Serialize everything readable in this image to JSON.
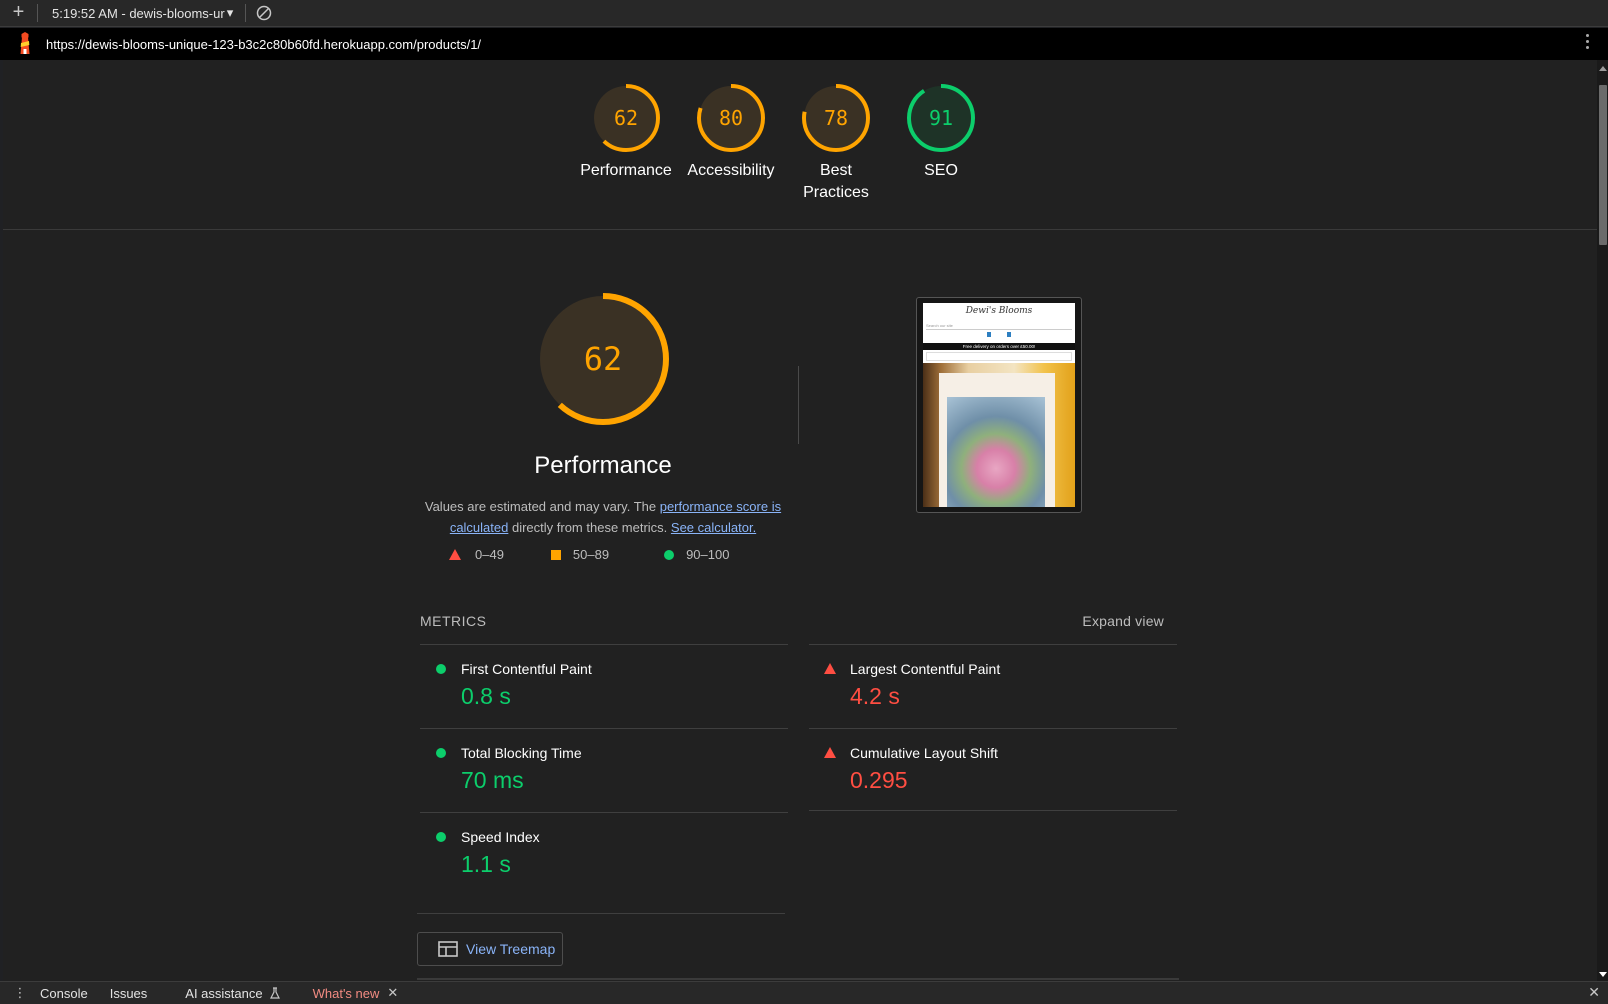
{
  "topbar": {
    "add_label": "+",
    "report_select": "5:19:52 AM - dewis-blooms-ur",
    "report_select_arrow": "▾"
  },
  "urlbar": {
    "url": "https://dewis-blooms-unique-123-b3c2c80b60fd.herokuapp.com/products/1/"
  },
  "summary": {
    "gauges": [
      {
        "score": "62",
        "label": "Performance",
        "value": 62,
        "color": "#ffa400"
      },
      {
        "score": "80",
        "label": "Accessibility",
        "value": 80,
        "color": "#ffa400"
      },
      {
        "score": "78",
        "label": "Best Practices",
        "value": 78,
        "color": "#ffa400"
      },
      {
        "score": "91",
        "label": "SEO",
        "value": 91,
        "color": "#0cce6b"
      }
    ]
  },
  "performance": {
    "score": "62",
    "value": 62,
    "title": "Performance",
    "desc_prefix": "Values are estimated and may vary. The ",
    "desc_link": "performance score is calculated",
    "desc_mid": " directly from these metrics. ",
    "desc_link2": "See calculator.",
    "legend": {
      "fail": "0–49",
      "average": "50–89",
      "pass": "90–100"
    }
  },
  "thumbnail": {
    "site_title": "Dewi's Blooms",
    "search_placeholder": "Search our site",
    "banner": "Free delivery on orders over £50.00!"
  },
  "metrics": {
    "heading": "METRICS",
    "expand": "Expand view",
    "items": [
      {
        "name": "First Contentful Paint",
        "value": "0.8 s",
        "status": "pass"
      },
      {
        "name": "Largest Contentful Paint",
        "value": "4.2 s",
        "status": "fail"
      },
      {
        "name": "Total Blocking Time",
        "value": "70 ms",
        "status": "pass"
      },
      {
        "name": "Cumulative Layout Shift",
        "value": "0.295",
        "status": "fail"
      },
      {
        "name": "Speed Index",
        "value": "1.1 s",
        "status": "pass"
      }
    ],
    "treemap_button": "View Treemap"
  },
  "drawer": {
    "tabs": [
      "Console",
      "Issues",
      "AI assistance",
      "What's new"
    ]
  },
  "colors": {
    "pass": "#0cce6b",
    "average": "#ffa400",
    "fail": "#ff4e42",
    "link": "#8ab4f8"
  }
}
